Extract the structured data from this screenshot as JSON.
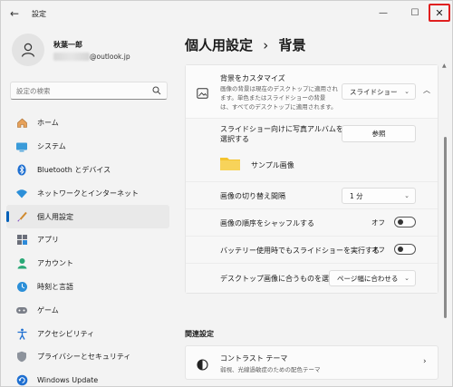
{
  "window": {
    "title": "設定",
    "back_glyph": "←",
    "minimize_glyph": "—",
    "maximize_glyph": "☐",
    "close_glyph": "✕"
  },
  "profile": {
    "name": "秋葉一郎",
    "email_suffix": "@outlook.jp"
  },
  "search": {
    "placeholder": "設定の検索"
  },
  "sidebar": {
    "items": [
      {
        "label": "ホーム",
        "icon": "home-icon"
      },
      {
        "label": "システム",
        "icon": "system-icon"
      },
      {
        "label": "Bluetooth とデバイス",
        "icon": "bluetooth-icon"
      },
      {
        "label": "ネットワークとインターネット",
        "icon": "wifi-icon"
      },
      {
        "label": "個人用設定",
        "icon": "brush-icon",
        "selected": true
      },
      {
        "label": "アプリ",
        "icon": "apps-icon"
      },
      {
        "label": "アカウント",
        "icon": "account-icon"
      },
      {
        "label": "時刻と言語",
        "icon": "globe-icon"
      },
      {
        "label": "ゲーム",
        "icon": "gamepad-icon"
      },
      {
        "label": "アクセシビリティ",
        "icon": "accessibility-icon"
      },
      {
        "label": "プライバシーとセキュリティ",
        "icon": "shield-icon"
      },
      {
        "label": "Windows Update",
        "icon": "update-icon"
      }
    ]
  },
  "page": {
    "breadcrumb_parent": "個人用設定",
    "breadcrumb_sep": "›",
    "breadcrumb_current": "背景"
  },
  "background": {
    "title": "背景をカスタマイズ",
    "description_lines": [
      "画像の背景は現在のデスクトップに適用され",
      "ます。単色またはスライドショーの背景",
      "は、すべてのデスクトップに適用されます。"
    ],
    "type_value": "スライドショー",
    "album_label_lines": [
      "スライドショー向けに写真アルバムを",
      "選択する"
    ],
    "browse_label": "参照",
    "folder_name": "サンプル画像",
    "interval_label": "画像の切り替え間隔",
    "interval_value": "1 分",
    "shuffle_label": "画像の順序をシャッフルする",
    "shuffle_state": "オフ",
    "battery_label": "バッテリー使用時でもスライドショーを実行する",
    "battery_state": "オフ",
    "fit_label": "デスクトップ画像に合うものを選択",
    "fit_value": "ページ幅に合わせる"
  },
  "related": {
    "section_title": "関連設定",
    "contrast_title": "コントラスト テーマ",
    "contrast_desc": "弱視、光線過敏症のための配色テーマ"
  },
  "colors": {
    "accent": "#005fb8",
    "folder": "#f4c430",
    "close_highlight": "#e02020"
  }
}
